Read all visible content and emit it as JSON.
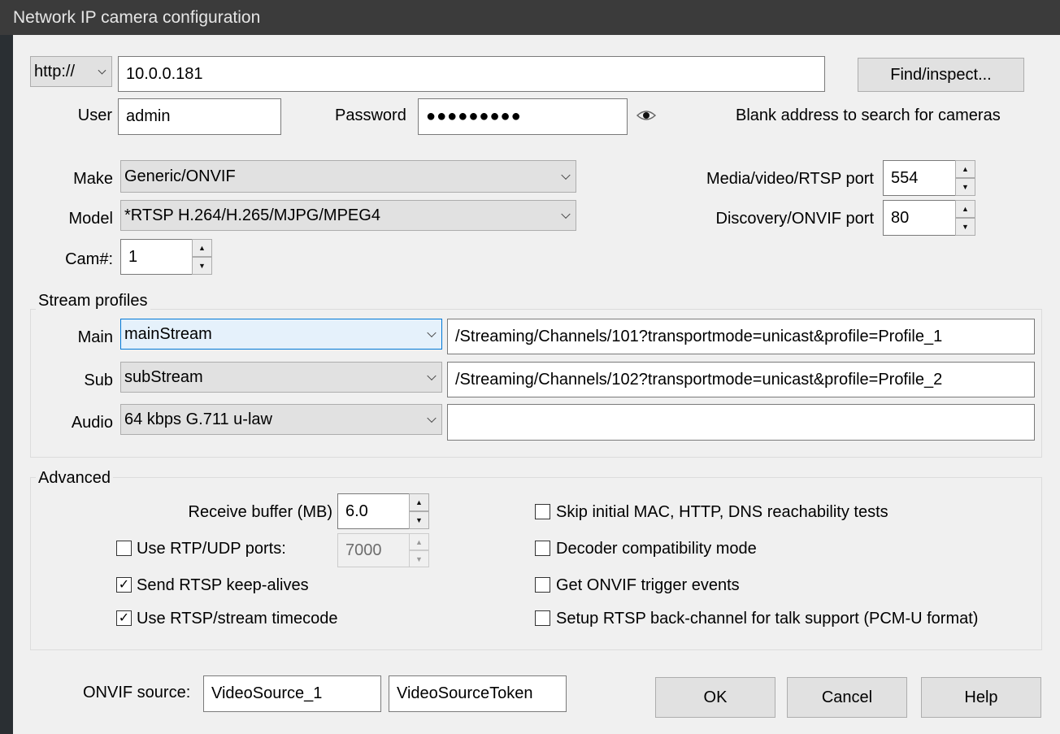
{
  "window": {
    "title": "Network IP camera configuration"
  },
  "address": {
    "scheme": "http://",
    "value": "10.0.0.181",
    "find_button": "Find/inspect...",
    "hint": "Blank address to search for cameras"
  },
  "credentials": {
    "user_label": "User",
    "user_value": "admin",
    "password_label": "Password",
    "password_value": "●●●●●●●●●",
    "show_password_icon": "eye-icon"
  },
  "camera": {
    "make_label": "Make",
    "make_value": "Generic/ONVIF",
    "model_label": "Model",
    "model_value": "*RTSP H.264/H.265/MJPG/MPEG4",
    "cam_label": "Cam#:",
    "cam_value": "1",
    "media_port_label": "Media/video/RTSP port",
    "media_port_value": "554",
    "discovery_port_label": "Discovery/ONVIF port",
    "discovery_port_value": "80"
  },
  "stream_profiles": {
    "title": "Stream profiles",
    "main_label": "Main",
    "main_value": "mainStream",
    "main_path": "/Streaming/Channels/101?transportmode=unicast&profile=Profile_1",
    "sub_label": "Sub",
    "sub_value": "subStream",
    "sub_path": "/Streaming/Channels/102?transportmode=unicast&profile=Profile_2",
    "audio_label": "Audio",
    "audio_value": "64 kbps G.711 u-law",
    "audio_path": ""
  },
  "advanced": {
    "title": "Advanced",
    "receive_buffer_label": "Receive buffer (MB)",
    "receive_buffer_value": "6.0",
    "rtp_udp_label": "Use RTP/UDP ports:",
    "rtp_udp_checked": false,
    "rtp_udp_value": "7000",
    "keepalive_label": "Send RTSP keep-alives",
    "keepalive_checked": true,
    "timecode_label": "Use RTSP/stream timecode",
    "timecode_checked": true,
    "skip_tests_label": "Skip initial MAC, HTTP, DNS reachability tests",
    "skip_tests_checked": false,
    "decoder_compat_label": "Decoder compatibility mode",
    "decoder_compat_checked": false,
    "onvif_events_label": "Get ONVIF trigger events",
    "onvif_events_checked": false,
    "backchannel_label": "Setup RTSP back-channel for talk support (PCM-U format)",
    "backchannel_checked": false
  },
  "onvif": {
    "label": "ONVIF source:",
    "source_value": "VideoSource_1",
    "token_value": "VideoSourceToken"
  },
  "buttons": {
    "ok": "OK",
    "cancel": "Cancel",
    "help": "Help"
  },
  "colors": {
    "titlebar": "#3b3b3b",
    "focus_border": "#0078d7",
    "focus_fill": "#e5f1fb"
  }
}
